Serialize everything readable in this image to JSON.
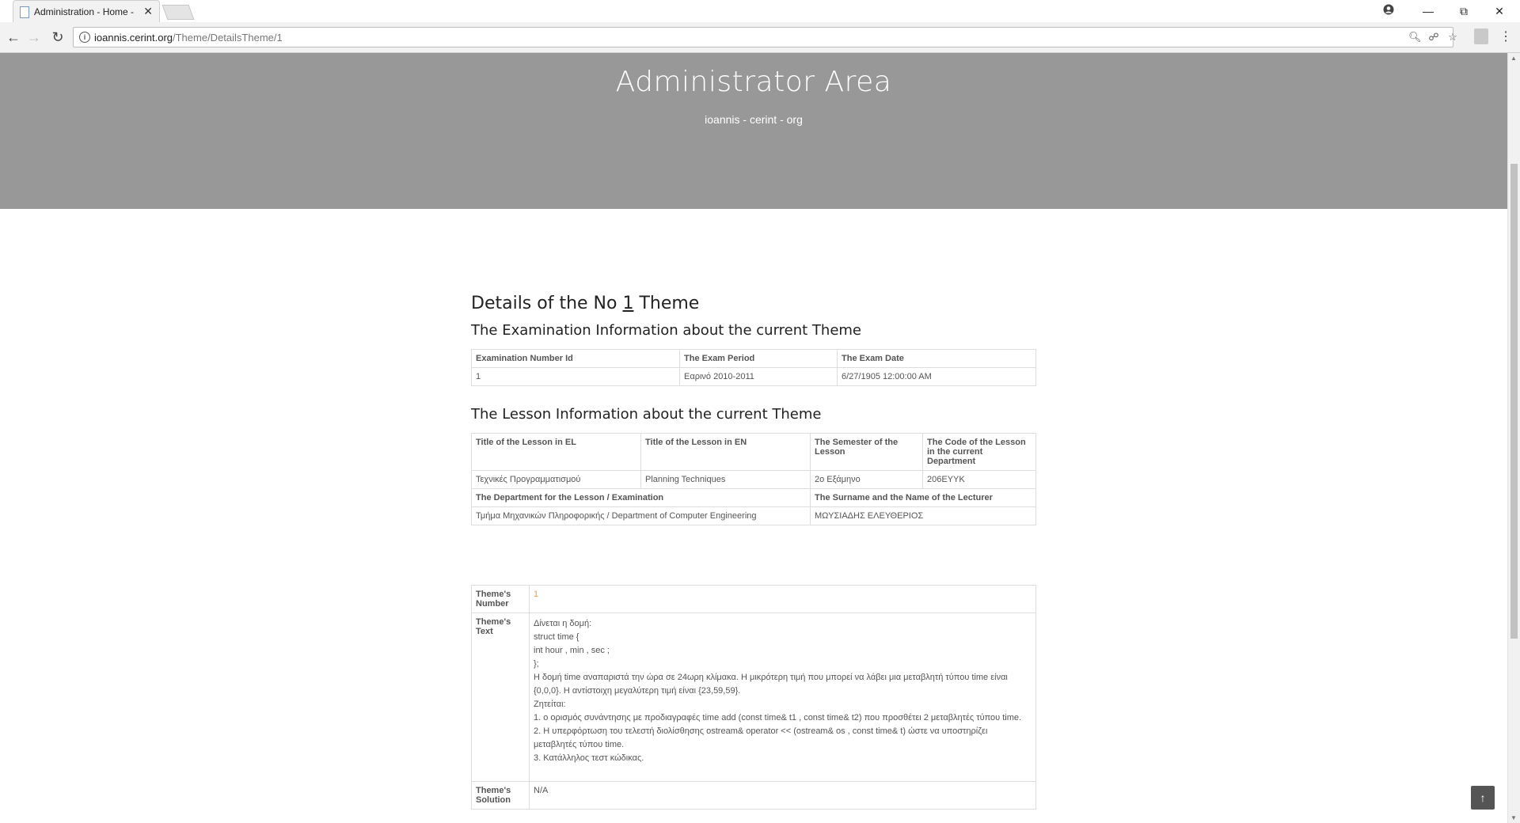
{
  "browser": {
    "tab_title": "Administration - Home - ",
    "tab_close": "✕",
    "url_host": "ioannis.cerint.org",
    "url_path": "/Theme/DetailsTheme/1",
    "icons": [
      "back-icon",
      "forward-icon",
      "reload-icon",
      "info-icon",
      "zoom-icon",
      "translate-icon",
      "star-icon",
      "extension-icon",
      "menu-icon",
      "account-icon",
      "minimize-icon",
      "restore-icon",
      "close-icon"
    ]
  },
  "hero": {
    "title": "Administrator Area",
    "subtitle": "ioannis - cerint - org"
  },
  "page": {
    "heading_prefix": "Details of the No ",
    "heading_number": "1",
    "heading_suffix": " Theme",
    "exam_section_title": "The Examination Information about the current Theme",
    "lesson_section_title": "The Lesson Information about the current Theme"
  },
  "exam_table": {
    "headers": [
      "Examination Number Id",
      "The Exam Period",
      "The Exam Date"
    ],
    "row": [
      "1",
      "Εαρινό 2010-2011",
      "6/27/1905 12:00:00 AM"
    ]
  },
  "lesson_table": {
    "headers": [
      "Title of the Lesson in EL",
      "Title of the Lesson in EN",
      "The Semester of the Lesson",
      "The Code of the Lesson in the current Department"
    ],
    "row": [
      "Τεχνικές Προγραμματισμού",
      "Planning Techniques",
      "2ο Εξάμηνο",
      "206ΕΥΥΚ"
    ],
    "dept_header": "The Department for the Lesson / Examination",
    "lecturer_header": "The Surname and the Name of the Lecturer",
    "dept_value": "Τμήμα Μηχανικών Πληροφορικής / Department of Computer Engineering",
    "lecturer_value": "ΜΩΥΣΙΑΔΗΣ ΕΛΕΥΘΕΡΙΟΣ"
  },
  "theme_table": {
    "number_label": "Theme's Number",
    "number_value": "1",
    "text_label": "Theme's Text",
    "text_lines": [
      "Δίνεται η δομή:",
      "struct time {",
      "int hour , min , sec ;",
      "};",
      "Η δομή time αναπαριστά την ώρα σε 24ωρη κλίμακα. Η μικρότερη τιμή που μπορεί να λάβει μια μεταβλητή τύπου time είναι {0,0,0}. Η αντίστοιχη μεγαλύτερη τιμή είναι {23,59,59}.",
      "Ζητείται:",
      "1. ο ορισμός συνάντησης με προδιαγραφές time add (const time& t1 , const time& t2) που προσθέτει 2 μεταβλητές τύπου time.",
      "2. Η υπερφόρτωση του τελεστή διολίσθησης ostream& operator << (ostream& os , const time& t) ώστε να υποστηρίζει μεταβλητές τύπου time.",
      "3. Κατάλληλος τεστ κώδικας."
    ],
    "solution_label": "Theme's Solution",
    "solution_value": "N/A"
  },
  "scroll_top_label": "↑"
}
